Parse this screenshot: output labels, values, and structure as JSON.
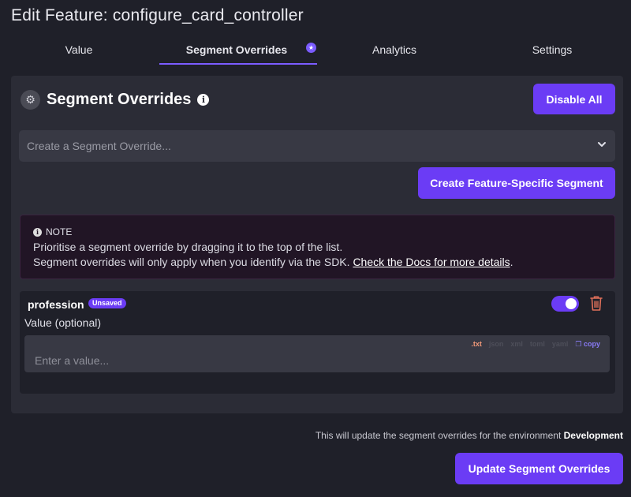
{
  "page_title": "Edit Feature: configure_card_controller",
  "tabs": [
    {
      "label": "Value"
    },
    {
      "label": "Segment Overrides",
      "active": true,
      "badge": "★"
    },
    {
      "label": "Analytics"
    },
    {
      "label": "Settings"
    }
  ],
  "segment_overrides": {
    "title": "Segment Overrides",
    "disable_all_label": "Disable All",
    "select_placeholder": "Create a Segment Override...",
    "create_specific_label": "Create Feature-Specific Segment",
    "note": {
      "label": "NOTE",
      "line1": "Prioritise a segment override by dragging it to the top of the list.",
      "line2": "Segment overrides will only apply when you identify via the SDK. ",
      "link": "Check the Docs for more details",
      "line2_end": "."
    },
    "override": {
      "name": "profession",
      "badge": "Unsaved",
      "enabled": true,
      "value_label": "Value (optional)",
      "value_placeholder": "Enter a value...",
      "value": "",
      "formats": [
        ".txt",
        "json",
        "xml",
        "toml",
        "yaml"
      ],
      "active_format": ".txt",
      "copy_label": "copy"
    }
  },
  "footer": {
    "message": "This will update the segment overrides for the environment ",
    "environment": "Development",
    "update_label": "Update Segment Overrides"
  },
  "colors": {
    "accent": "#6b3cf5",
    "background": "#1f2029",
    "panel": "#2b2c36",
    "trash": "#e0705a"
  }
}
